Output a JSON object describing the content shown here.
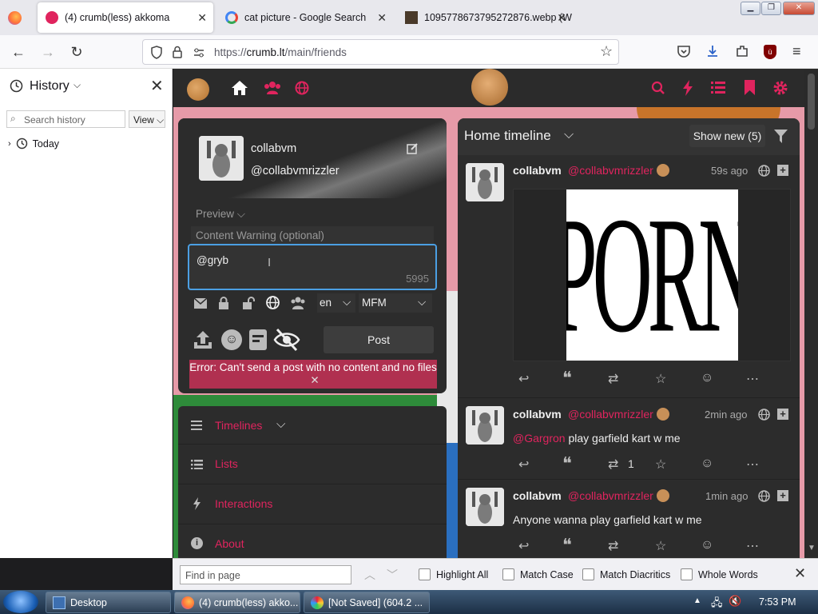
{
  "browser": {
    "tabs": [
      {
        "title": "(4) crumb(less) akkoma",
        "close": "✕"
      },
      {
        "title": "cat picture - Google Search",
        "close": "✕"
      },
      {
        "title": "1095778673795272876.webp (W",
        "close": "✕"
      }
    ],
    "url": {
      "prefix": "https://",
      "host": "crumb.lt",
      "path": "/main/friends"
    }
  },
  "sidebar": {
    "title": "History",
    "search_placeholder": "Search history",
    "view_button": "View",
    "tree": [
      {
        "label": "Today"
      }
    ]
  },
  "post_form": {
    "name": "collabvm",
    "handle": "@collabvmrizzler",
    "preview_label": "Preview",
    "cw_placeholder": "Content Warning (optional)",
    "text": "@gryb",
    "char_count": "5995",
    "language": "en",
    "format": "MFM",
    "post_button": "Post",
    "error": "Error: Can't send a post with no content and no files",
    "error_close": "✕"
  },
  "nav_panel": {
    "items": [
      {
        "label": "Timelines",
        "icon": "bars-icon"
      },
      {
        "label": "Lists",
        "icon": "list-icon"
      },
      {
        "label": "Interactions",
        "icon": "bolt-icon"
      },
      {
        "label": "About",
        "icon": "info-icon"
      }
    ]
  },
  "timeline": {
    "title": "Home timeline",
    "show_new": "Show new (5)",
    "posts": [
      {
        "name": "collabvm",
        "handle": "@collabvmrizzler",
        "time": "59s ago",
        "content": "",
        "image_text": "PORN",
        "repeat_count": ""
      },
      {
        "name": "collabvm",
        "handle": "@collabvmrizzler",
        "time": "2min ago",
        "mention": "@Gargron",
        "content": "play garfield kart w me",
        "repeat_count": "1"
      },
      {
        "name": "collabvm",
        "handle": "@collabvmrizzler",
        "time": "1min ago",
        "content": "Anyone wanna play garfield kart w me",
        "repeat_count": ""
      }
    ]
  },
  "findbar": {
    "placeholder": "Find in page",
    "options": [
      "Highlight All",
      "Match Case",
      "Match Diacritics",
      "Whole Words"
    ]
  },
  "taskbar": {
    "items": [
      {
        "label": "Desktop"
      },
      {
        "label": "(4) crumb(less) akko..."
      },
      {
        "label": "[Not Saved]  (604.2 ..."
      }
    ],
    "clock": "7:53 PM"
  },
  "colors": {
    "accent": "#e0245e",
    "panel": "#2c2c2c",
    "background": "#e69aa8"
  }
}
